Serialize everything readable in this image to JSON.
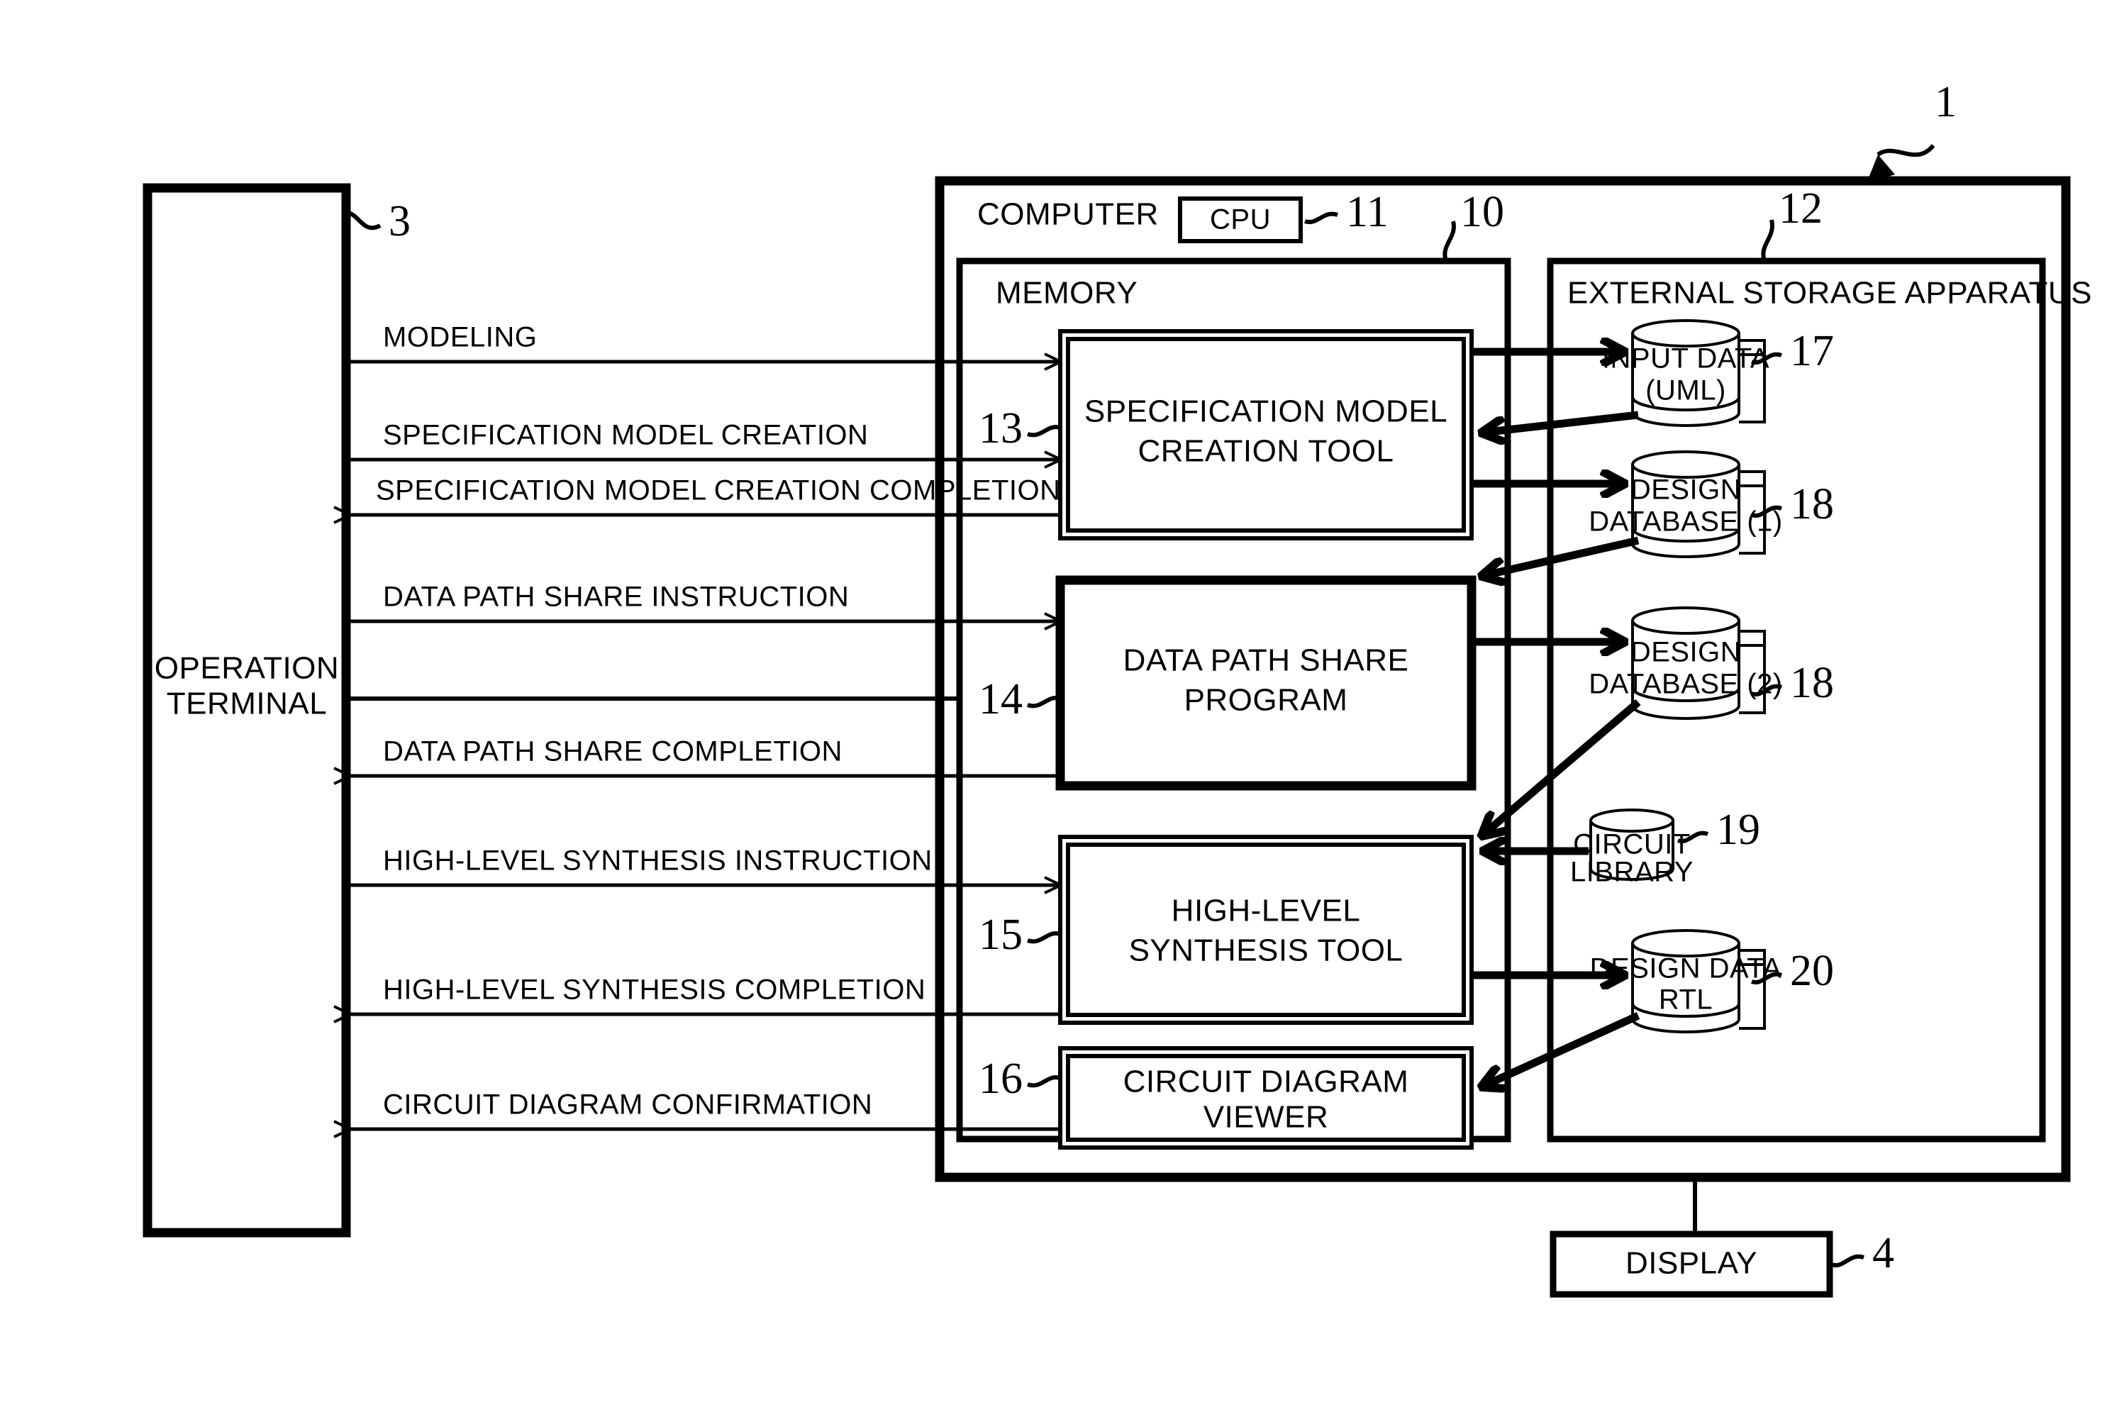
{
  "figure": {
    "system_ref": "1",
    "terminal": {
      "label_line1": "OPERATION",
      "label_line2": "TERMINAL",
      "ref": "3"
    },
    "computer": {
      "title": "COMPUTER",
      "ref": "10",
      "cpu": {
        "label": "CPU",
        "ref": "11"
      },
      "memory": {
        "title": "MEMORY",
        "modules": [
          {
            "ref": "13",
            "line1": "SPECIFICATION MODEL",
            "line2": "CREATION TOOL",
            "emphasis": "double"
          },
          {
            "ref": "14",
            "line1": "DATA PATH SHARE",
            "line2": "PROGRAM",
            "emphasis": "bold"
          },
          {
            "ref": "15",
            "line1": "HIGH-LEVEL",
            "line2": "SYNTHESIS TOOL",
            "emphasis": "double"
          },
          {
            "ref": "16",
            "line1": "CIRCUIT DIAGRAM",
            "line2": "VIEWER",
            "emphasis": "double"
          }
        ]
      }
    },
    "storage": {
      "title": "EXTERNAL STORAGE APPARATUS",
      "ref": "12",
      "stores": [
        {
          "ref": "17",
          "line1": "INPUT DATA",
          "line2": "(UML)",
          "shape": "cylinder-tabbed"
        },
        {
          "ref": "18",
          "line1": "DESIGN",
          "line2": "DATABASE (1)",
          "shape": "cylinder-tabbed"
        },
        {
          "ref": "18",
          "line1": "DESIGN",
          "line2": "DATABASE (2)",
          "shape": "cylinder-tabbed"
        },
        {
          "ref": "19",
          "line1": "CIRCUIT",
          "line2": "LIBRARY",
          "shape": "cylinder"
        },
        {
          "ref": "20",
          "line1": "DESIGN DATA",
          "line2": "RTL",
          "shape": "cylinder-tabbed"
        }
      ]
    },
    "display": {
      "label": "DISPLAY",
      "ref": "4"
    },
    "messages": [
      {
        "text": "MODELING",
        "direction": "to-computer"
      },
      {
        "text": "SPECIFICATION MODEL CREATION",
        "direction": "to-computer"
      },
      {
        "text": "SPECIFICATION MODEL CREATION COMPLETION",
        "direction": "to-terminal"
      },
      {
        "text": "DATA PATH SHARE INSTRUCTION",
        "direction": "to-computer"
      },
      {
        "text": "DATA PATH SHARE COMPLETION",
        "direction": "to-terminal"
      },
      {
        "text": "HIGH-LEVEL SYNTHESIS INSTRUCTION",
        "direction": "to-computer"
      },
      {
        "text": "HIGH-LEVEL SYNTHESIS COMPLETION",
        "direction": "to-terminal"
      },
      {
        "text": "CIRCUIT DIAGRAM CONFIRMATION",
        "direction": "to-terminal"
      }
    ],
    "colors": {
      "ink": "#000000",
      "paper": "#ffffff"
    }
  }
}
